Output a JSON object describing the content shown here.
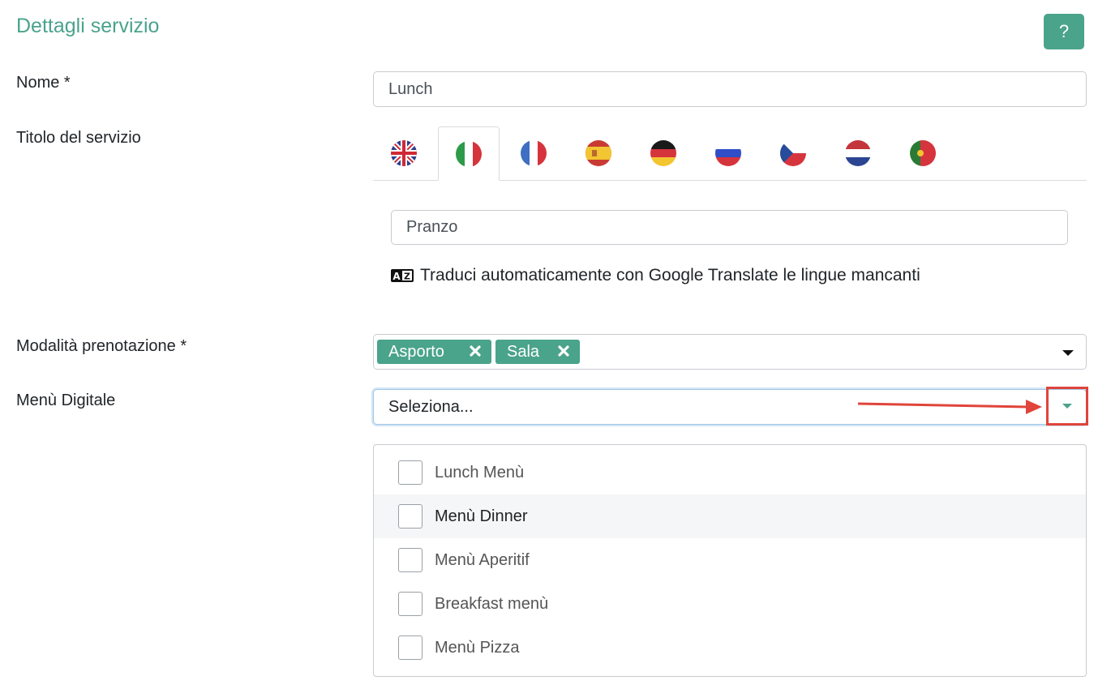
{
  "section": {
    "title": "Dettagli servizio",
    "help_label": "?"
  },
  "nome": {
    "label": "Nome  *",
    "value": "Lunch"
  },
  "titolo": {
    "label": "Titolo del servizio",
    "languages": [
      {
        "code": "en",
        "icon": "uk-flag-icon"
      },
      {
        "code": "it",
        "icon": "italy-flag-icon",
        "active": true
      },
      {
        "code": "fr",
        "icon": "france-flag-icon"
      },
      {
        "code": "es",
        "icon": "spain-flag-icon"
      },
      {
        "code": "de",
        "icon": "germany-flag-icon"
      },
      {
        "code": "ru",
        "icon": "russia-flag-icon"
      },
      {
        "code": "cz",
        "icon": "czech-flag-icon"
      },
      {
        "code": "nl",
        "icon": "netherlands-flag-icon"
      },
      {
        "code": "pt",
        "icon": "portugal-flag-icon"
      }
    ],
    "value": "Pranzo",
    "translate_text": "Traduci automaticamente con Google Translate le lingue mancanti"
  },
  "modalita": {
    "label": "Modalità prenotazione  *",
    "tags": [
      "Asporto",
      "Sala"
    ]
  },
  "menu_digitale": {
    "label": "Menù Digitale",
    "placeholder": "Seleziona...",
    "options": [
      "Lunch Menù",
      "Menù Dinner",
      "Menù Aperitif",
      "Breakfast menù",
      "Menù Pizza"
    ],
    "highlighted_option": "Menù Dinner"
  },
  "colors": {
    "accent": "#4aa38b",
    "annotation": "#e0443a"
  }
}
